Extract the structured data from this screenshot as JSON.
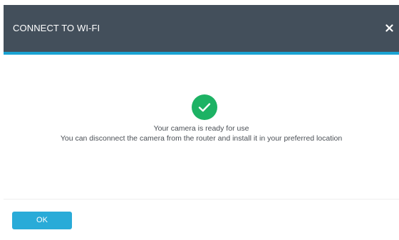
{
  "dialog": {
    "title": "CONNECT TO WI-FI",
    "close_icon": "close-icon",
    "status_icon": "check-circle-icon",
    "message_line1": "Your camera is ready for use",
    "message_line2": "You can disconnect the camera from the router and install it in your preferred location",
    "ok_label": "OK"
  },
  "colors": {
    "header_background": "#434f5b",
    "header_accent": "#1aa3d3",
    "success_green": "#1db264",
    "button_blue": "#29abd8"
  }
}
